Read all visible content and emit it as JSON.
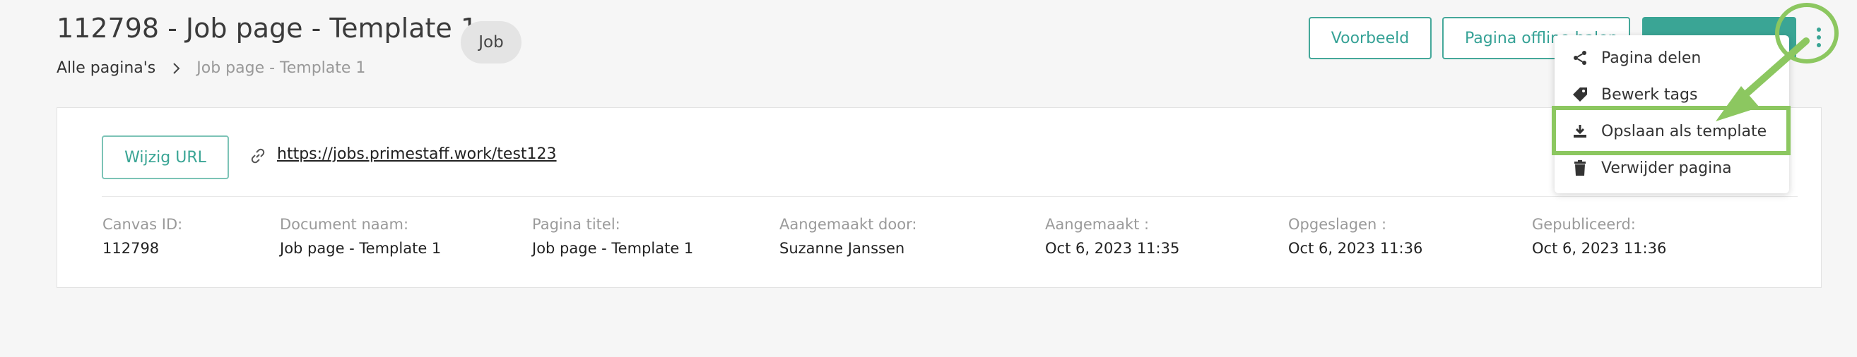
{
  "header": {
    "title": "112798 - Job page - Template 1",
    "tag": "Job",
    "breadcrumb": {
      "root": "Alle pagina's",
      "current": "Job page - Template 1"
    }
  },
  "toolbar": {
    "preview_label": "Voorbeeld",
    "offline_label": "Pagina offline halen"
  },
  "url_section": {
    "change_url_label": "Wijzig URL",
    "url": "https://jobs.primestaff.work/test123"
  },
  "meta": [
    {
      "label": "Canvas ID:",
      "value": "112798"
    },
    {
      "label": "Document naam:",
      "value": "Job page - Template 1"
    },
    {
      "label": "Pagina titel:",
      "value": "Job page - Template 1"
    },
    {
      "label": "Aangemaakt door:",
      "value": "Suzanne Janssen"
    },
    {
      "label": "Aangemaakt :",
      "value": "Oct 6, 2023 11:35"
    },
    {
      "label": "Opgeslagen :",
      "value": "Oct 6, 2023 11:36"
    },
    {
      "label": "Gepubliceerd:",
      "value": "Oct 6, 2023 11:36"
    }
  ],
  "menu": {
    "items": [
      {
        "label": "Pagina delen",
        "icon": "share-icon"
      },
      {
        "label": "Bewerk tags",
        "icon": "tag-icon"
      },
      {
        "label": "Opslaan als template",
        "icon": "download-icon"
      },
      {
        "label": "Verwijder pagina",
        "icon": "trash-icon"
      }
    ]
  },
  "colors": {
    "accent": "#3aa595",
    "annotation": "#8cc760"
  }
}
